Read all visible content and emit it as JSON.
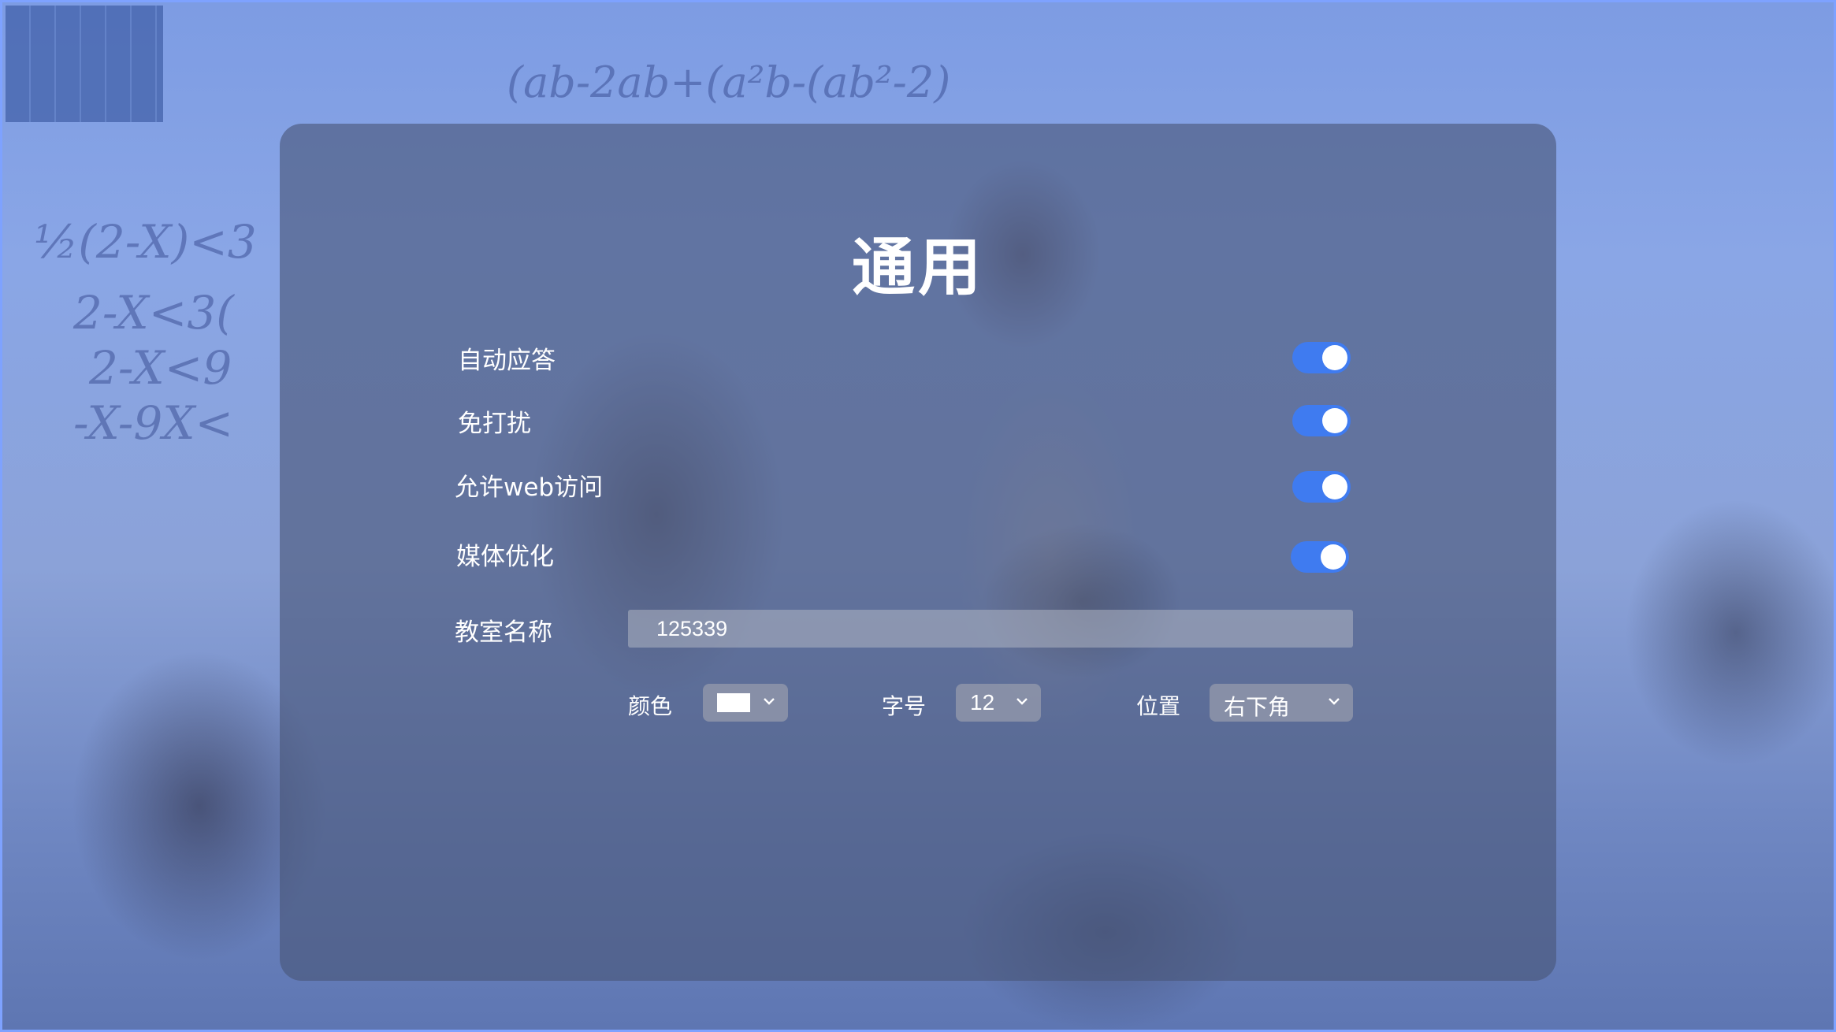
{
  "panel": {
    "title": "通用",
    "toggles": [
      {
        "label": "自动应答",
        "on": true
      },
      {
        "label": "免打扰",
        "on": true
      },
      {
        "label": "允许web访问",
        "on": true
      },
      {
        "label": "媒体优化",
        "on": true
      }
    ],
    "classroom_name": {
      "label": "教室名称",
      "value": "125339"
    },
    "color": {
      "label": "颜色",
      "value": "#ffffff"
    },
    "font_size": {
      "label": "字号",
      "value": "12"
    },
    "position": {
      "label": "位置",
      "value": "右下角"
    }
  },
  "colors": {
    "toggle_on": "#3f7bf0",
    "panel_bg": "#485678",
    "text": "#ffffff"
  },
  "icons": [
    "chevron-down-icon"
  ]
}
